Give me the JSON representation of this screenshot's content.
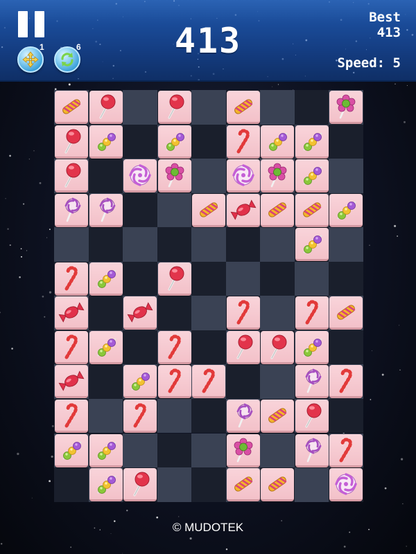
{
  "header": {
    "score": "413",
    "best_label": "Best",
    "best_value": "413",
    "speed_text": "Speed: 5"
  },
  "powerups": [
    {
      "name": "move-powerup",
      "icon": "move-arrows-icon",
      "count": "1"
    },
    {
      "name": "shuffle-powerup",
      "icon": "shuffle-arrows-icon",
      "count": "6"
    }
  ],
  "board": {
    "cols": 9,
    "rows": 12,
    "tiles": [
      [
        0,
        0,
        "twist-stick"
      ],
      [
        1,
        0,
        "lollipop"
      ],
      [
        3,
        0,
        "lollipop"
      ],
      [
        5,
        0,
        "twist-stick"
      ],
      [
        8,
        0,
        "flower-candy"
      ],
      [
        0,
        1,
        "lollipop"
      ],
      [
        1,
        1,
        "candy-skewer"
      ],
      [
        3,
        1,
        "candy-skewer"
      ],
      [
        5,
        1,
        "candy-cane"
      ],
      [
        6,
        1,
        "candy-skewer"
      ],
      [
        7,
        1,
        "candy-skewer"
      ],
      [
        0,
        2,
        "lollipop"
      ],
      [
        2,
        2,
        "swirl-candy"
      ],
      [
        3,
        2,
        "flower-candy"
      ],
      [
        5,
        2,
        "swirl-candy"
      ],
      [
        6,
        2,
        "flower-candy"
      ],
      [
        7,
        2,
        "candy-skewer"
      ],
      [
        0,
        3,
        "swirl-lollipop"
      ],
      [
        1,
        3,
        "swirl-lollipop"
      ],
      [
        4,
        3,
        "twist-stick"
      ],
      [
        5,
        3,
        "wrapped-candy"
      ],
      [
        6,
        3,
        "twist-stick"
      ],
      [
        7,
        3,
        "twist-stick"
      ],
      [
        8,
        3,
        "candy-skewer"
      ],
      [
        7,
        4,
        "candy-skewer"
      ],
      [
        0,
        5,
        "candy-cane"
      ],
      [
        1,
        5,
        "candy-skewer"
      ],
      [
        3,
        5,
        "lollipop"
      ],
      [
        0,
        6,
        "wrapped-candy"
      ],
      [
        2,
        6,
        "wrapped-candy"
      ],
      [
        5,
        6,
        "candy-cane"
      ],
      [
        7,
        6,
        "candy-cane"
      ],
      [
        8,
        6,
        "twist-stick"
      ],
      [
        0,
        7,
        "candy-cane"
      ],
      [
        1,
        7,
        "candy-skewer"
      ],
      [
        3,
        7,
        "candy-cane"
      ],
      [
        5,
        7,
        "lollipop"
      ],
      [
        6,
        7,
        "lollipop"
      ],
      [
        7,
        7,
        "candy-skewer"
      ],
      [
        0,
        8,
        "wrapped-candy"
      ],
      [
        2,
        8,
        "candy-skewer"
      ],
      [
        3,
        8,
        "candy-cane"
      ],
      [
        4,
        8,
        "candy-cane"
      ],
      [
        7,
        8,
        "swirl-lollipop"
      ],
      [
        8,
        8,
        "candy-cane"
      ],
      [
        0,
        9,
        "candy-cane"
      ],
      [
        2,
        9,
        "candy-cane"
      ],
      [
        5,
        9,
        "swirl-lollipop"
      ],
      [
        6,
        9,
        "twist-stick"
      ],
      [
        7,
        9,
        "lollipop"
      ],
      [
        0,
        10,
        "candy-skewer"
      ],
      [
        1,
        10,
        "candy-skewer"
      ],
      [
        5,
        10,
        "flower-candy"
      ],
      [
        7,
        10,
        "swirl-lollipop"
      ],
      [
        8,
        10,
        "candy-cane"
      ],
      [
        1,
        11,
        "candy-skewer"
      ],
      [
        2,
        11,
        "lollipop"
      ],
      [
        5,
        11,
        "twist-stick"
      ],
      [
        6,
        11,
        "twist-stick"
      ],
      [
        8,
        11,
        "swirl-candy"
      ]
    ]
  },
  "footer": {
    "copyright": "© MUDOTEK"
  },
  "colors": {
    "header_blue": "#1a4b98",
    "tile_pink": "#f6cad1",
    "board_light": "#3a4254",
    "board_dark": "#1a1f2c"
  }
}
